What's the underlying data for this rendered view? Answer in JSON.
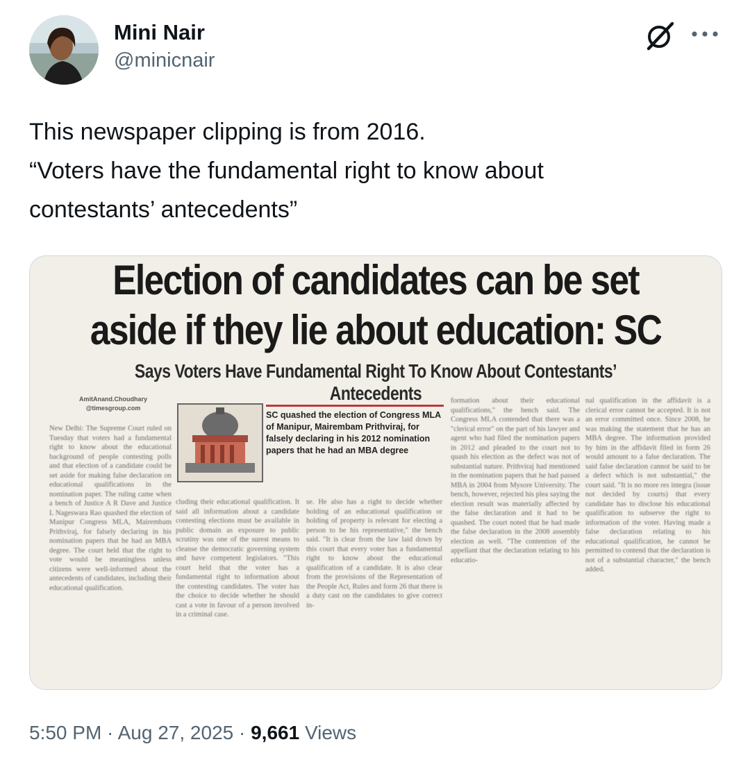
{
  "author": {
    "display_name": "Mini Nair",
    "handle": "@minicnair",
    "avatar_icon": "user-avatar"
  },
  "actions": {
    "grok_icon": "grok-icon",
    "more_icon": "more-options-icon"
  },
  "tweet": {
    "lines": [
      "This newspaper clipping is from 2016.",
      "“Voters have the fundamental right to know about",
      "contestants’ antecedents”"
    ]
  },
  "clipping": {
    "headline_line1": "Election of candidates can be set",
    "headline_line2": "aside if they lie about education: SC",
    "subhead": "Says Voters Have Fundamental Right To Know About Contestants’ Antecedents",
    "byline": "AmitAnand.Choudhary\n@timesgroup.com",
    "pullquote": "SC quashed the election of Congress MLA of Manipur, Mairembam Prithviraj, for falsely declaring in his 2012 nomination papers that he had an MBA degree",
    "col1": "New Delhi: The Supreme Court ruled on Tuesday that voters had a fundamental right to know about the educational background of people contesting polls and that election of a candidate could be set aside for making false declaration on educational qualifications in the nomination paper. The ruling came when a bench of Justice A R Dave and Justice L Nageswara Rao quashed the election of Manipur Congress MLA, Mairembam Prithviraj, for falsely declaring in his nomination papers that he had an MBA degree. The court held that the right to vote would be meaningless unless citizens were well-informed about the antecedents of candidates, including their educational qualification.",
    "col2": "cluding their educational qualification. It said all information about a candidate contesting elections must be available in public domain as exposure to public scrutiny was one of the surest means to cleanse the democratic governing system and have competent legislators. \"This court held that the voter has a fundamental right to information about the contesting candidates. The voter has the choice to decide whether he should cast a vote in favour of a person involved in a criminal case.",
    "col3": "se. He also has a right to decide whether holding of an educational qualification or holding of property is relevant for electing a person to be his representative,\" the bench said. \"It is clear from the law laid down by this court that every voter has a fundamental right to know about the educational qualification of a candidate. It is also clear from the provisions of the Representation of the People Act, Rules and form 26 that there is a duty cast on the candidates to give correct in-",
    "col4": "formation about their educational qualifications,\" the bench said. The Congress MLA contended that there was a \"clerical error\" on the part of his lawyer and agent who had filed the nomination papers in 2012 and pleaded to the court not to quash his election as the defect was not of substantial nature. Prithviraj had mentioned in the nomination papers that he had passed MBA in 2004 from Mysore University. The bench, however, rejected his plea saying the election result was materially affected by the false declaration and it had to be quashed. The court noted that he had made the false declaration in the 2008 assembly election as well. \"The contention of the appellant that the declaration relating to his educatio-",
    "col5": "nal qualification in the affidavit is a clerical error cannot be accepted. It is not an error committed once. Since 2008, he was making the statement that he has an MBA degree. The information provided by him in the affidavit filed in form 26 would amount to a false declaration. The said false declaration cannot be said to be a defect which is not substantial,\" the court said. \"It is no more res integra (issue not decided by courts) that every candidate has to disclose his educational qualification to subserve the right to information of the voter. Having made a false declaration relating to his educational qualification, he cannot be permitted to contend that the declaration is not of a substantial character,\" the bench added."
  },
  "meta": {
    "time": "5:50 PM",
    "date": "Aug 27, 2025",
    "sep1": " · ",
    "sep2": " · ",
    "views_count": "9,661",
    "views_label": " Views"
  }
}
